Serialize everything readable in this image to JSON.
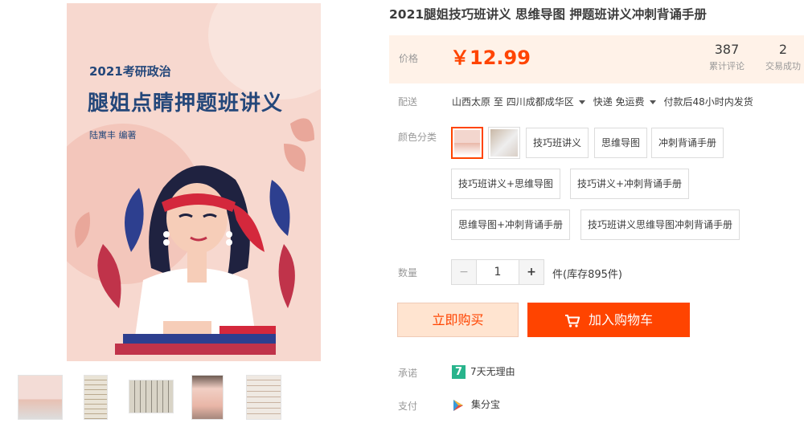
{
  "product": {
    "title": "2021腿姐技巧班讲义 思维导图 押题班讲义冲刺背诵手册",
    "cover": {
      "pretitle": "2021考研政治",
      "title": "腿姐点睛押题班讲义",
      "author": "陆寓丰 编著"
    }
  },
  "price": {
    "label": "价格",
    "value": "￥12.99",
    "color": "#ff4400"
  },
  "stats": [
    {
      "num": "387",
      "caption": "累计评论"
    },
    {
      "num": "2",
      "caption": "交易成功"
    }
  ],
  "shipping": {
    "label": "配送",
    "from": "山西太原",
    "to_word": "至",
    "to": "四川成都成华区",
    "method": "快递 免运费",
    "delivery": "付款后48小时内发货"
  },
  "sku": {
    "label": "颜色分类",
    "options": [
      "技巧班讲义",
      "思维导图",
      "冲刺背诵手册",
      "技巧班讲义+思维导图",
      "技巧讲义+冲刺背诵手册",
      "思维导图+冲刺背诵手册",
      "技巧班讲义思维导图冲刺背诵手册"
    ]
  },
  "quantity": {
    "label": "数量",
    "minus": "−",
    "value": "1",
    "plus": "+",
    "stock": "件(库存895件)"
  },
  "buttons": {
    "buy": "立即购买",
    "cart": "加入购物车"
  },
  "promise": {
    "label": "承诺",
    "badge": "7",
    "text": "7天无理由"
  },
  "payment": {
    "label": "支付",
    "text": "集分宝"
  },
  "colors": {
    "accent": "#ff4400",
    "price_bg": "#fff2e8",
    "buy_bg": "#ffe4d0",
    "badge": "#28b48c"
  }
}
